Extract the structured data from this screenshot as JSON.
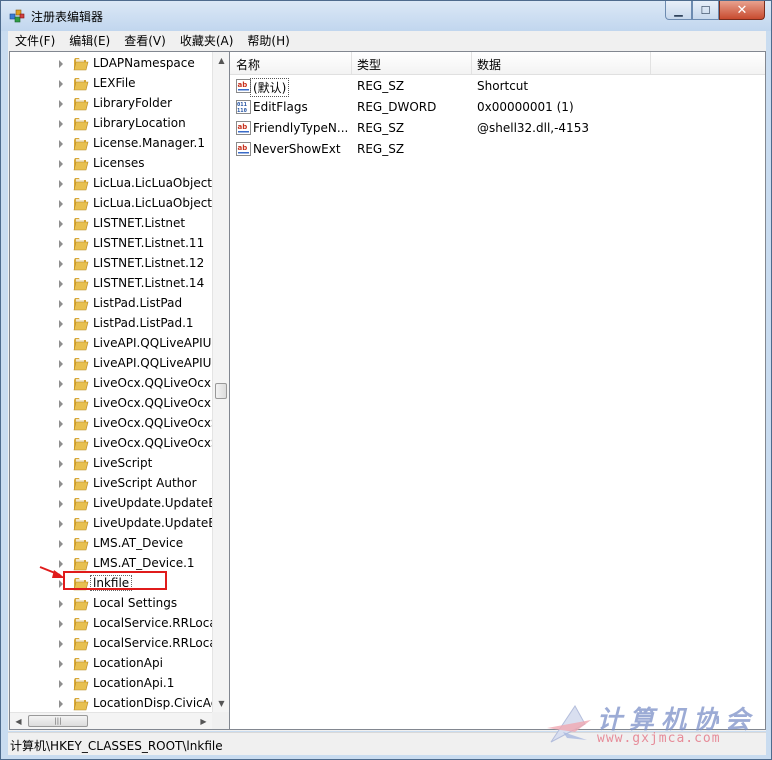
{
  "window": {
    "title": "注册表编辑器",
    "controls": {
      "minimize": "▁",
      "maximize": "☐",
      "close": "✕"
    }
  },
  "menu": [
    "文件(F)",
    "编辑(E)",
    "查看(V)",
    "收藏夹(A)",
    "帮助(H)"
  ],
  "tree": {
    "items": [
      "LDAPNamespace",
      "LEXFile",
      "LibraryFolder",
      "LibraryLocation",
      "License.Manager.1",
      "Licenses",
      "LicLua.LicLuaObject",
      "LicLua.LicLuaObject.",
      "LISTNET.Listnet",
      "LISTNET.Listnet.11",
      "LISTNET.Listnet.12",
      "LISTNET.Listnet.14",
      "ListPad.ListPad",
      "ListPad.ListPad.1",
      "LiveAPI.QQLiveAPIU",
      "LiveAPI.QQLiveAPIU",
      "LiveOcx.QQLiveOcx",
      "LiveOcx.QQLiveOcx.",
      "LiveOcx.QQLiveOcxS",
      "LiveOcx.QQLiveOcxS",
      "LiveScript",
      "LiveScript Author",
      "LiveUpdate.UpdateE",
      "LiveUpdate.UpdateE",
      "LMS.AT_Device",
      "LMS.AT_Device.1",
      "lnkfile",
      "Local Settings",
      "LocalService.RRLoca",
      "LocalService.RRLoca",
      "LocationApi",
      "LocationApi.1",
      "LocationDisp.CivicAc"
    ],
    "selected": "lnkfile"
  },
  "list": {
    "columns": {
      "name": "名称",
      "type": "类型",
      "data": "数据"
    },
    "rows": [
      {
        "name": "(默认)",
        "type": "REG_SZ",
        "data": "Shortcut",
        "icon": "string-value-icon"
      },
      {
        "name": "EditFlags",
        "type": "REG_DWORD",
        "data": "0x00000001 (1)",
        "icon": "binary-value-icon"
      },
      {
        "name": "FriendlyTypeN...",
        "type": "REG_SZ",
        "data": "@shell32.dll,-4153",
        "icon": "string-value-icon"
      },
      {
        "name": "NeverShowExt",
        "type": "REG_SZ",
        "data": "",
        "icon": "string-value-icon"
      }
    ]
  },
  "status": {
    "path": "计算机\\HKEY_CLASSES_ROOT\\lnkfile"
  },
  "watermark": {
    "title": "计算机协会",
    "url": "www.gxjmca.com"
  },
  "colors": {
    "highlight": "#e01b1b",
    "folder": "#e8c050"
  }
}
